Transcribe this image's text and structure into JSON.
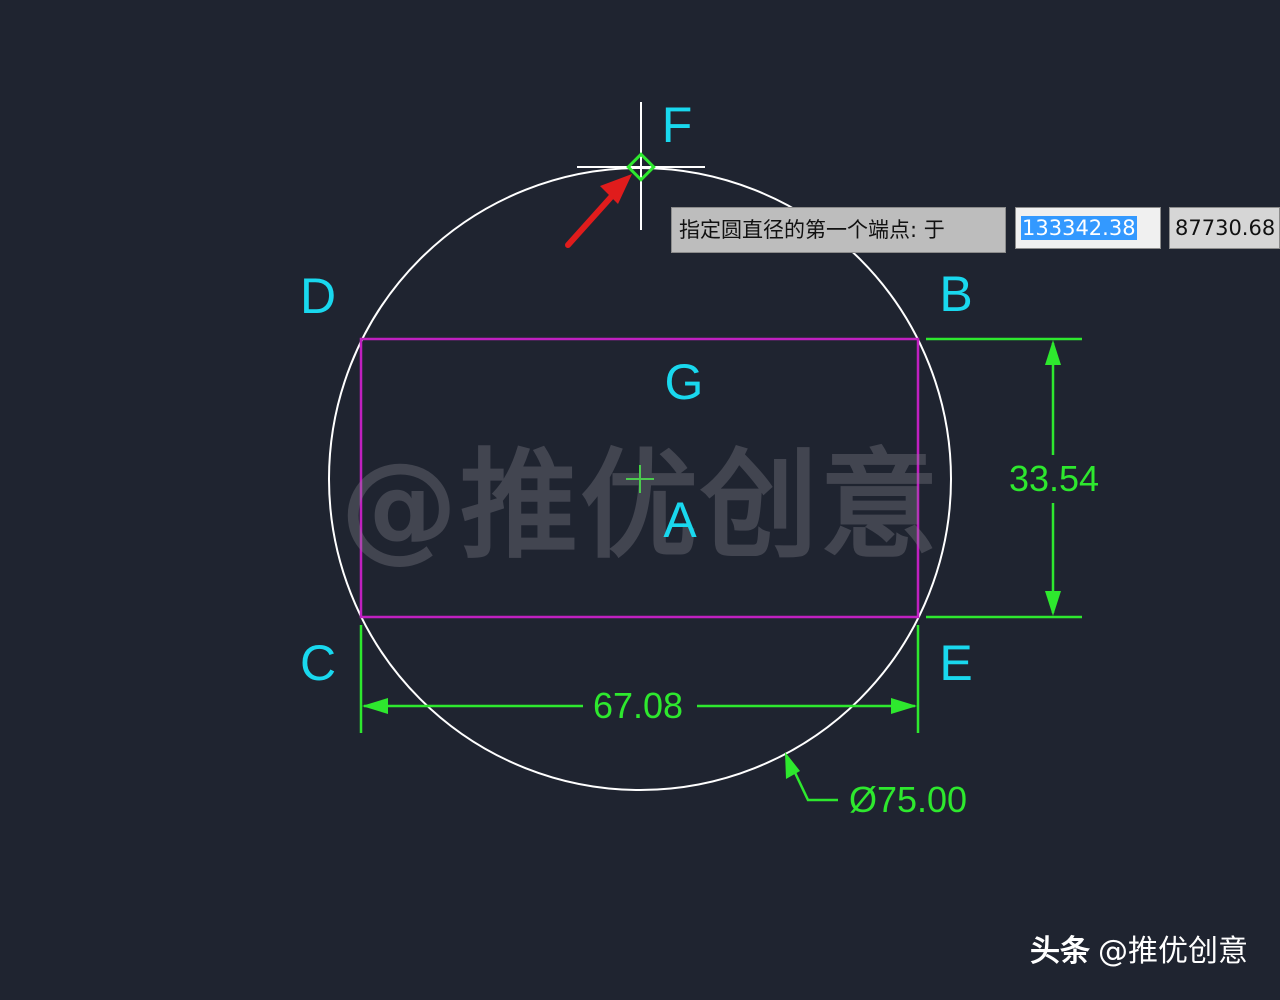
{
  "drawing": {
    "points": {
      "F": "F",
      "D": "D",
      "B": "B",
      "G": "G",
      "A": "A",
      "C": "C",
      "E": "E"
    },
    "dimensions": {
      "height": "33.54",
      "width": "67.08",
      "diameter": "Ø75.00"
    },
    "colors": {
      "background": "#1f2430",
      "circle": "#ffffff",
      "rectangle": "#c020c0",
      "dimension": "#2ee82e",
      "label": "#19d8ee",
      "arrow": "#e01c1c"
    }
  },
  "command": {
    "prompt": "指定圆直径的第一个端点: 于",
    "x_value": "133342.38",
    "y_value": "87730.68"
  },
  "watermark": "@推优创意",
  "footer": {
    "brand": "头条",
    "handle": "@推优创意"
  }
}
